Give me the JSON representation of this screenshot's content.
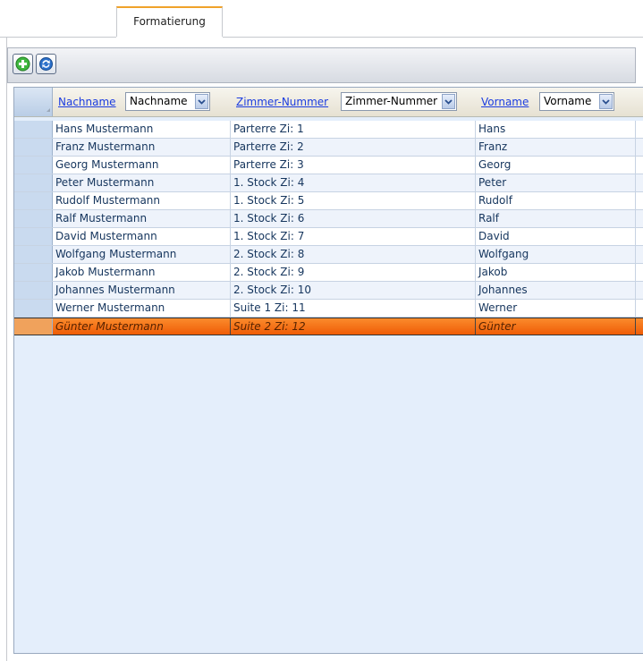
{
  "tabs": [
    {
      "label": "Formatierung"
    }
  ],
  "toolbar": {
    "buttons": [
      {
        "name": "add",
        "icon": "add-icon"
      },
      {
        "name": "refresh",
        "icon": "refresh-icon"
      }
    ]
  },
  "grid": {
    "columns": [
      {
        "link": "Nachname",
        "filter_value": "Nachname"
      },
      {
        "link": "Zimmer-Nummer",
        "filter_value": "Zimmer-Nummer"
      },
      {
        "link": "Vorname",
        "filter_value": "Vorname"
      }
    ],
    "rows": [
      {
        "nachname": "Hans Mustermann",
        "zimmer": "Parterre Zi: 1",
        "vorname": "Hans"
      },
      {
        "nachname": "Franz Mustermann",
        "zimmer": "Parterre Zi: 2",
        "vorname": "Franz"
      },
      {
        "nachname": "Georg Mustermann",
        "zimmer": "Parterre Zi: 3",
        "vorname": "Georg"
      },
      {
        "nachname": "Peter Mustermann",
        "zimmer": "1. Stock Zi: 4",
        "vorname": "Peter"
      },
      {
        "nachname": "Rudolf Mustermann",
        "zimmer": "1. Stock Zi: 5",
        "vorname": "Rudolf"
      },
      {
        "nachname": "Ralf Mustermann",
        "zimmer": "1. Stock Zi: 6",
        "vorname": "Ralf"
      },
      {
        "nachname": "David Mustermann",
        "zimmer": "1. Stock Zi: 7",
        "vorname": "David"
      },
      {
        "nachname": "Wolfgang Mustermann",
        "zimmer": "2. Stock Zi: 8",
        "vorname": "Wolfgang"
      },
      {
        "nachname": "Jakob Mustermann",
        "zimmer": "2. Stock Zi: 9",
        "vorname": "Jakob"
      },
      {
        "nachname": "Johannes Mustermann",
        "zimmer": "2. Stock Zi: 10",
        "vorname": "Johannes"
      },
      {
        "nachname": "Werner Mustermann",
        "zimmer": "Suite 1 Zi: 11",
        "vorname": "Werner"
      },
      {
        "nachname": "Günter Mustermann",
        "zimmer": "Suite 2 Zi: 12",
        "vorname": "Günter",
        "selected": true
      }
    ]
  },
  "colors": {
    "accent_tab": "#f0a22a",
    "selected_row": "#f26a12",
    "link": "#1c3de0"
  }
}
